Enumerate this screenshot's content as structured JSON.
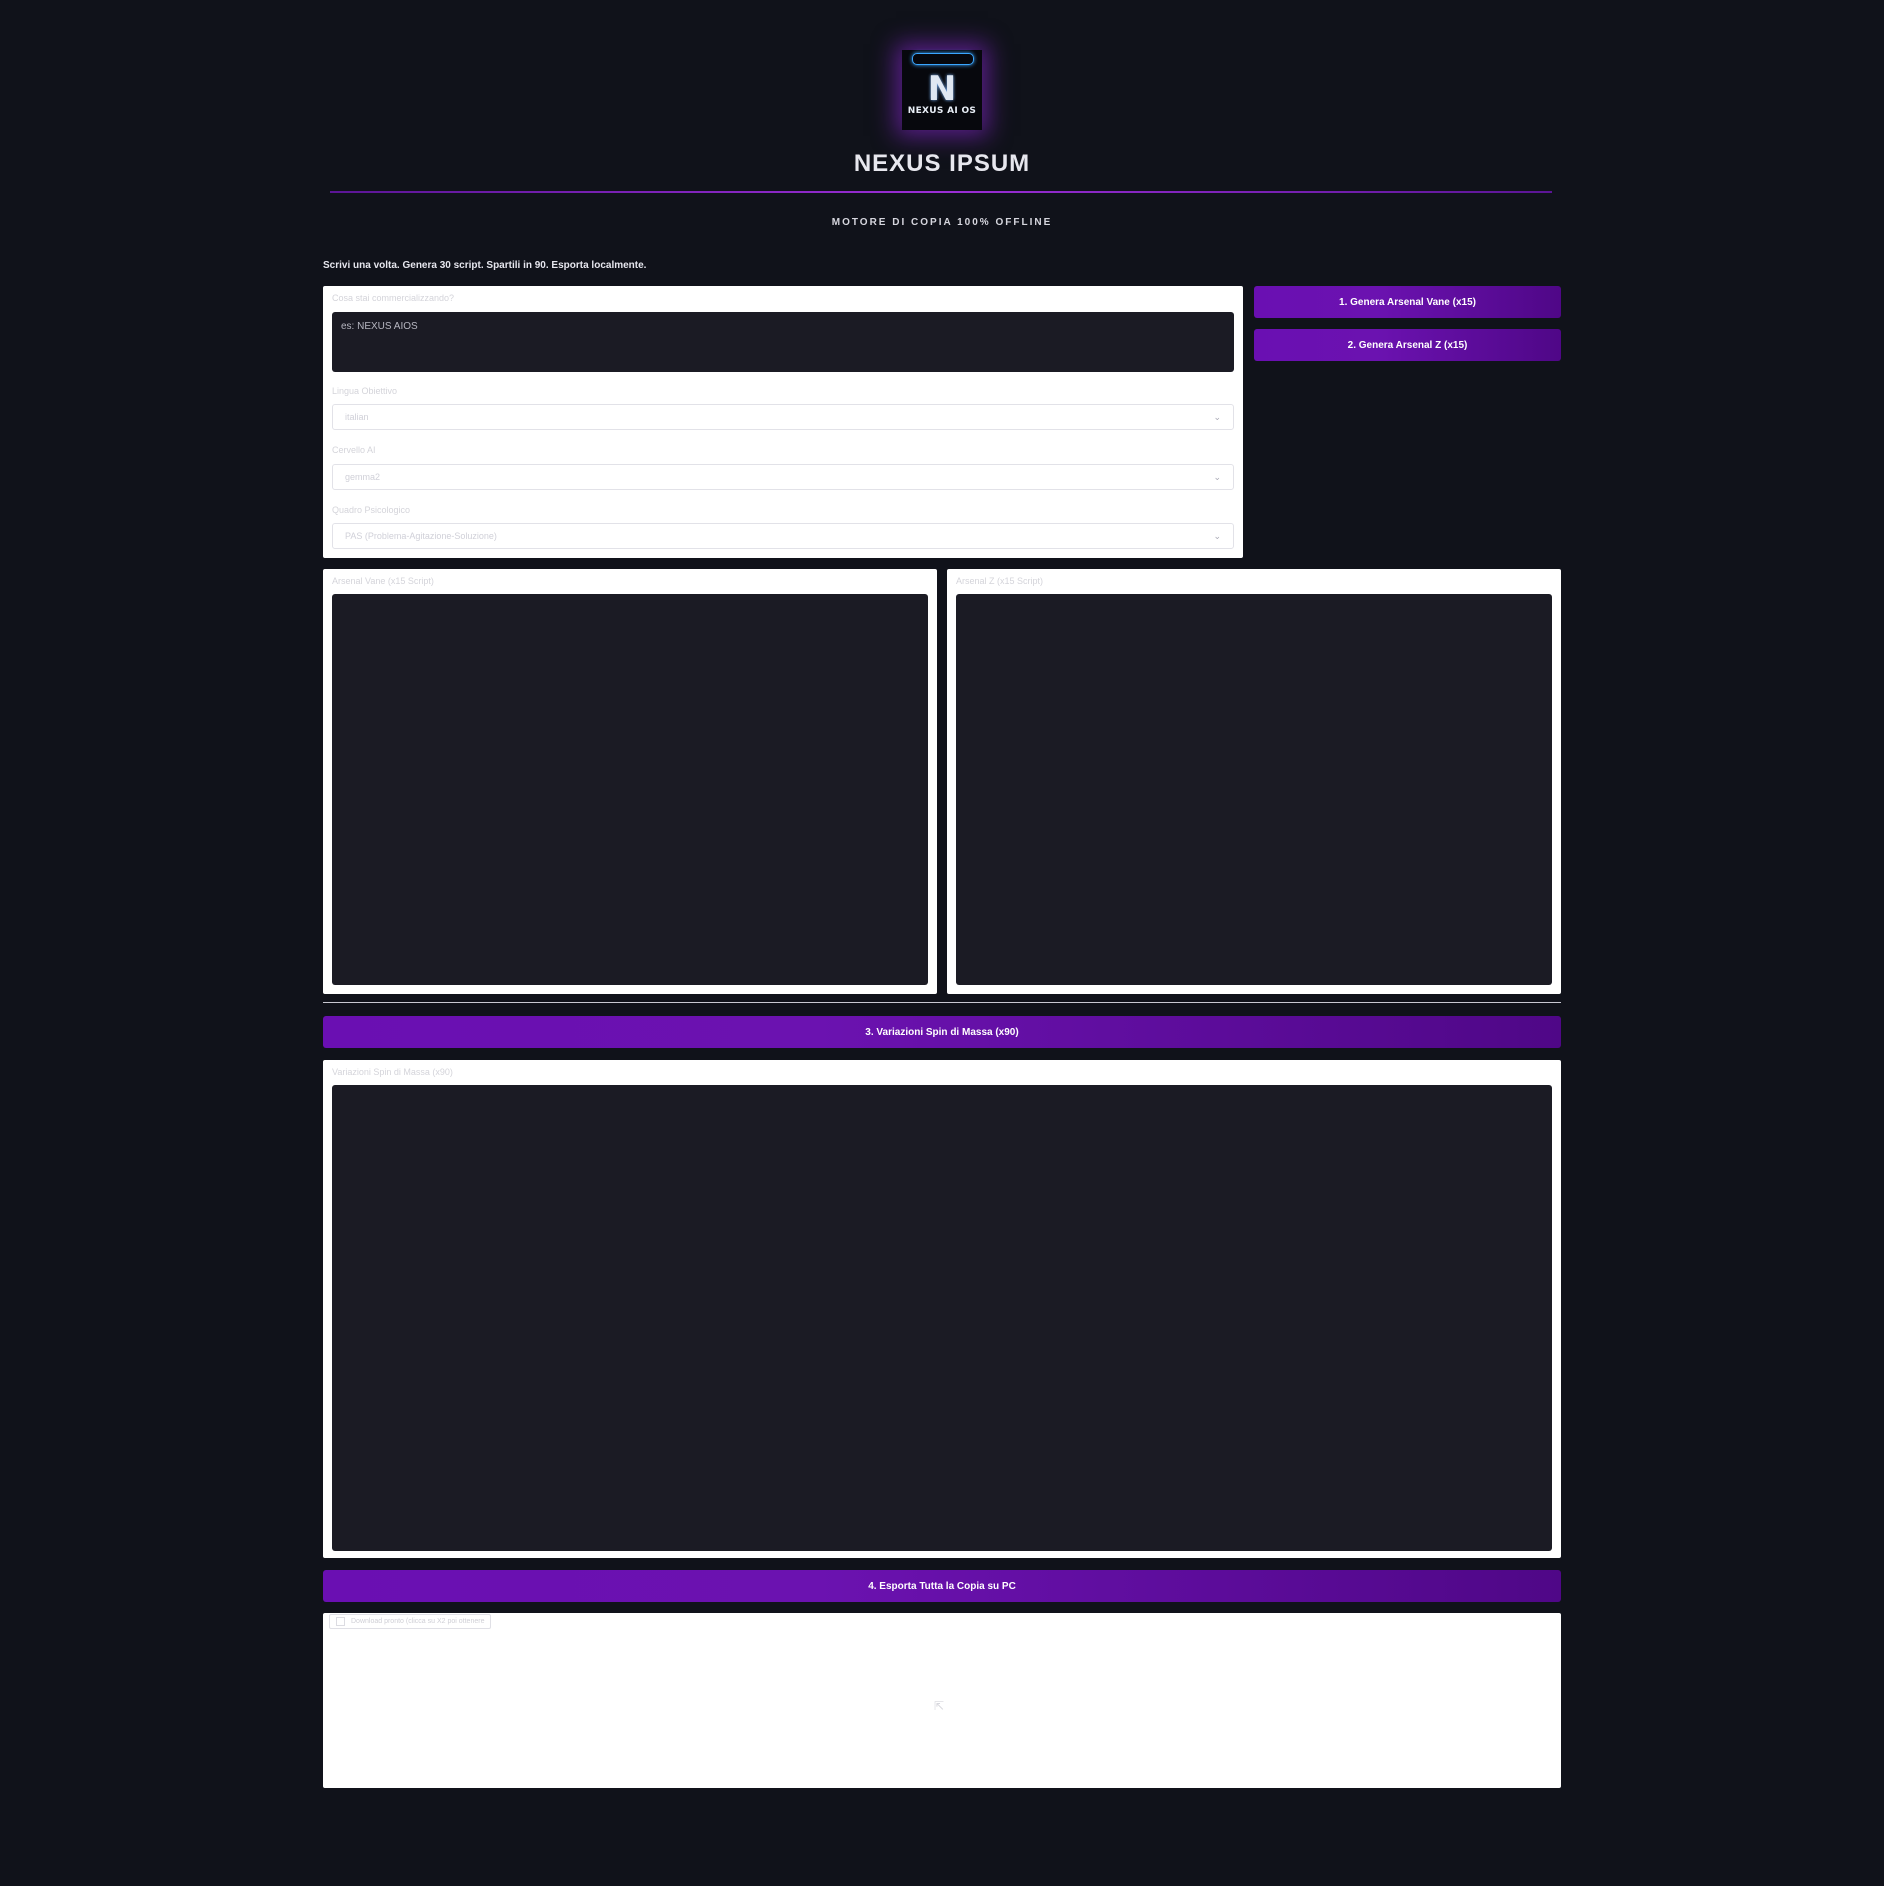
{
  "header": {
    "logo": {
      "alt": "NEXUS AI OS",
      "monogram": "N",
      "text": "NEXUS AI OS"
    },
    "title": "NEXUS IPSUM",
    "subtitle": "MOTORE DI COPIA 100% OFFLINE",
    "tagline": "Scrivi una volta. Genera 30 script. Spartili in 90. Esporta localmente."
  },
  "form": {
    "product": {
      "label": "Cosa stai commercializzando?",
      "placeholder": "es: NEXUS AIOS"
    },
    "language": {
      "label": "Lingua Obiettivo",
      "value": "italian"
    },
    "brain": {
      "label": "Cervello AI",
      "value": "gemma2"
    },
    "framework": {
      "label": "Quadro Psicologico",
      "value": "PAS (Problema-Agitazione-Soluzione)"
    }
  },
  "actions": {
    "generate_vane": "1. Genera Arsenal Vane (x15)",
    "generate_z": "2. Genera Arsenal Z (x15)",
    "spin": "3. Variazioni Spin di Massa (x90)",
    "export": "4. Esporta Tutta la Copia su PC"
  },
  "outputs": {
    "vane_label": "Arsenal Vane (x15 Script)",
    "z_label": "Arsenal Z (x15 Script)",
    "spin_label": "Variazioni Spin di Massa (x90)"
  },
  "download": {
    "label": "Download pronto (clicca su X2 poi ottenere"
  },
  "colors": {
    "background": "#10121a",
    "accent": "#6a0fb2",
    "panel": "#ffffff",
    "field": "#1b1b24"
  }
}
